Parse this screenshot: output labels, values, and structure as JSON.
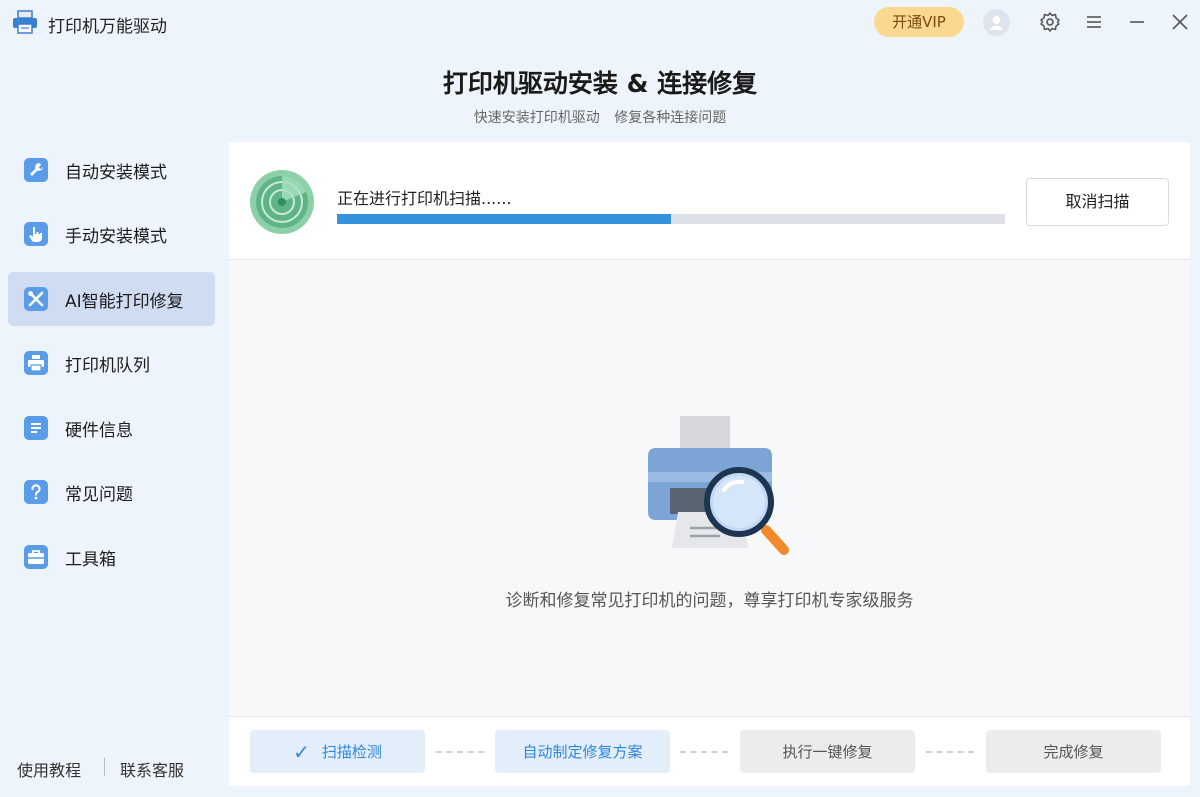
{
  "app": {
    "title": "打印机万能驱动",
    "vip_label": "开通VIP"
  },
  "header": {
    "title": "打印机驱动安装 & 连接修复",
    "subtitle": "快速安装打印机驱动 修复各种连接问题"
  },
  "sidebar": {
    "items": [
      {
        "label": "自动安装模式",
        "icon": "wrench-icon"
      },
      {
        "label": "手动安装模式",
        "icon": "hand-pointer-icon"
      },
      {
        "label": "AI智能打印修复",
        "icon": "tools-icon"
      },
      {
        "label": "打印机队列",
        "icon": "printer-icon"
      },
      {
        "label": "硬件信息",
        "icon": "document-icon"
      },
      {
        "label": "常见问题",
        "icon": "question-icon"
      },
      {
        "label": "工具箱",
        "icon": "toolbox-icon"
      }
    ],
    "active_index": 2,
    "footer": {
      "tutorial": "使用教程",
      "support": "联系客服"
    }
  },
  "scan": {
    "status": "正在进行打印机扫描......",
    "progress": 0.5,
    "cancel_label": "取消扫描"
  },
  "main": {
    "description": "诊断和修复常见打印机的问题，尊享打印机专家级服务"
  },
  "steps": [
    {
      "label": "扫描检测",
      "state": "done"
    },
    {
      "label": "自动制定修复方案",
      "state": "current"
    },
    {
      "label": "执行一键修复",
      "state": "pending"
    },
    {
      "label": "完成修复",
      "state": "pending"
    }
  ],
  "colors": {
    "accent": "#3592dd",
    "vip_bg": "#fbd890",
    "sidebar_active": "#cfdcf2",
    "background": "#eef4fb"
  }
}
